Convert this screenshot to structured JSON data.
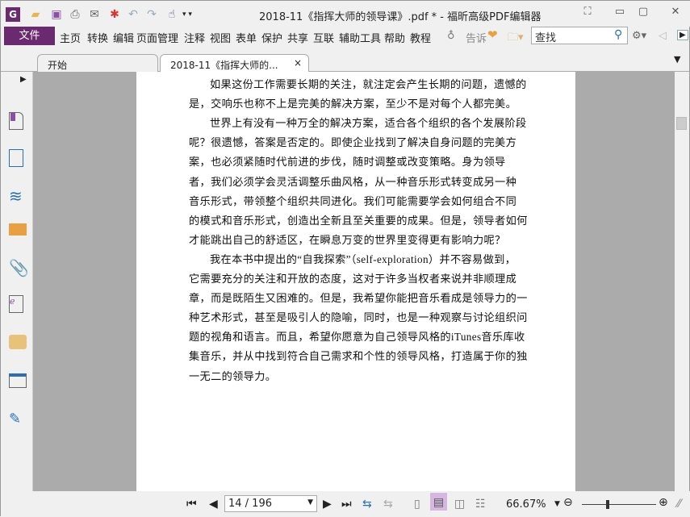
{
  "window": {
    "title": "2018-11《指挥大师的领导课》.pdf * - 福昕高级PDF编辑器"
  },
  "menu": {
    "file": "文件",
    "items": [
      "主页",
      "转换",
      "编辑",
      "页面管理",
      "注释",
      "视图",
      "表单",
      "保护",
      "共享",
      "互联",
      "辅助工具",
      "帮助",
      "教程"
    ],
    "tell_me": "告诉",
    "search_placeholder": "查找"
  },
  "tabs": [
    {
      "label": "开始"
    },
    {
      "label": "2018-11《指挥大师的...",
      "close": "×"
    }
  ],
  "document": {
    "lines": [
      {
        "text": "如果这份工作需要长期的关注，就注定会产生长期的问题，遗憾的",
        "indent": true
      },
      {
        "text": "是，交响乐也称不上是完美的解决方案，至少不是对每个人都完美。",
        "indent": false
      },
      {
        "text": "世界上有没有一种万全的解决方案，适合各个组织的各个发展阶段",
        "indent": true
      },
      {
        "text": "呢？很遗憾，答案是否定的。即使企业找到了解决自身问题的完美方",
        "indent": false
      },
      {
        "text": "案，也必须紧随时代前进的步伐，随时调整或改变策略。身为领导",
        "indent": false
      },
      {
        "text": "者，我们必须学会灵活调整乐曲风格，从一种音乐形式转变成另一种",
        "indent": false
      },
      {
        "text": "音乐形式，带领整个组织共同进化。我们可能需要学会如何组合不同",
        "indent": false
      },
      {
        "text": "的模式和音乐形式，创造出全新且至关重要的成果。但是，领导者如何",
        "indent": false
      },
      {
        "text": "才能跳出自己的舒适区，在瞬息万变的世界里变得更有影响力呢？",
        "indent": false
      },
      {
        "text": "我在本书中提出的“自我探索”（self-exploration）并不容易做到，",
        "indent": true
      },
      {
        "text": "它需要充分的关注和开放的态度，这对于许多当权者来说并非顺理成",
        "indent": false
      },
      {
        "text": "章，而是既陌生又困难的。但是，我希望你能把音乐看成是领导力的一",
        "indent": false
      },
      {
        "text": "种艺术形式，甚至是吸引人的隐喻，同时，也是一种观察与讨论组织问",
        "indent": false
      },
      {
        "text": "题的视角和语言。而且，希望你愿意为自己领导风格的iTunes音乐库收",
        "indent": false
      },
      {
        "text": "集音乐，并从中找到符合自己需求和个性的领导风格，打造属于你的独",
        "indent": false
      },
      {
        "text": "一无二的领导力。",
        "indent": false
      }
    ]
  },
  "status": {
    "page": "14 / 196",
    "zoom": "66.67%",
    "zoom_slider_fraction": 0.35
  },
  "colors": {
    "brand": "#6b2a70",
    "doc_bg": "#ababab"
  }
}
